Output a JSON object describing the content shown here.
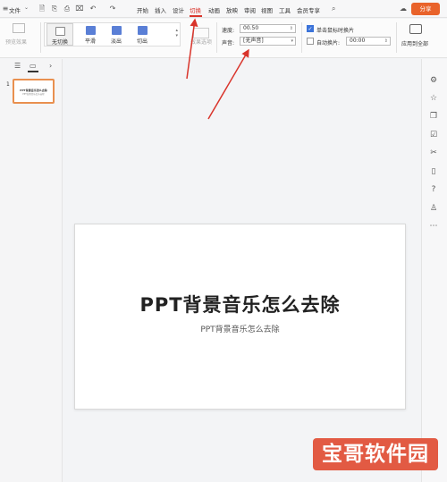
{
  "menubar": {
    "file_label": "文件",
    "tabs": [
      {
        "label": "开始"
      },
      {
        "label": "插入"
      },
      {
        "label": "设计"
      },
      {
        "label": "切换"
      },
      {
        "label": "动画"
      },
      {
        "label": "放映"
      },
      {
        "label": "审阅"
      },
      {
        "label": "视图"
      },
      {
        "label": "工具"
      },
      {
        "label": "会员专享"
      }
    ],
    "active_tab": "切换",
    "share_label": "分享",
    "accent_color": "#d9342b",
    "share_color": "#e9632b"
  },
  "ribbon": {
    "preview_label": "预览效果",
    "transitions": [
      {
        "label": "无切换",
        "selected": true
      },
      {
        "label": "平滑"
      },
      {
        "label": "淡出"
      },
      {
        "label": "切出"
      }
    ],
    "effect_options_label": "效果选项",
    "speed_label": "速度:",
    "speed_value": "00.50",
    "sound_label": "声音:",
    "sound_value": "[无声音]",
    "click_advance_label": "单击鼠标时换片",
    "click_advance_checked": true,
    "auto_advance_label": "自动换片:",
    "auto_advance_checked": false,
    "auto_advance_value": "00:00",
    "apply_all_label": "应用到全部"
  },
  "slides_panel": {
    "slide_number": "1",
    "thumb_title": "PPT背景音乐怎么去除",
    "thumb_subtitle": "PPT背景音乐怎么去除"
  },
  "slide": {
    "title": "PPT背景音乐怎么去除",
    "subtitle": "PPT背景音乐怎么去除"
  },
  "right_toolbar": {
    "icons": [
      "settings-sliders-icon",
      "star-icon",
      "copy-icon",
      "check-image-icon",
      "scissors-icon",
      "book-icon",
      "help-icon",
      "shirt-icon",
      "more-icon"
    ]
  },
  "watermark": {
    "text": "宝哥软件园",
    "color": "#e25a43"
  }
}
